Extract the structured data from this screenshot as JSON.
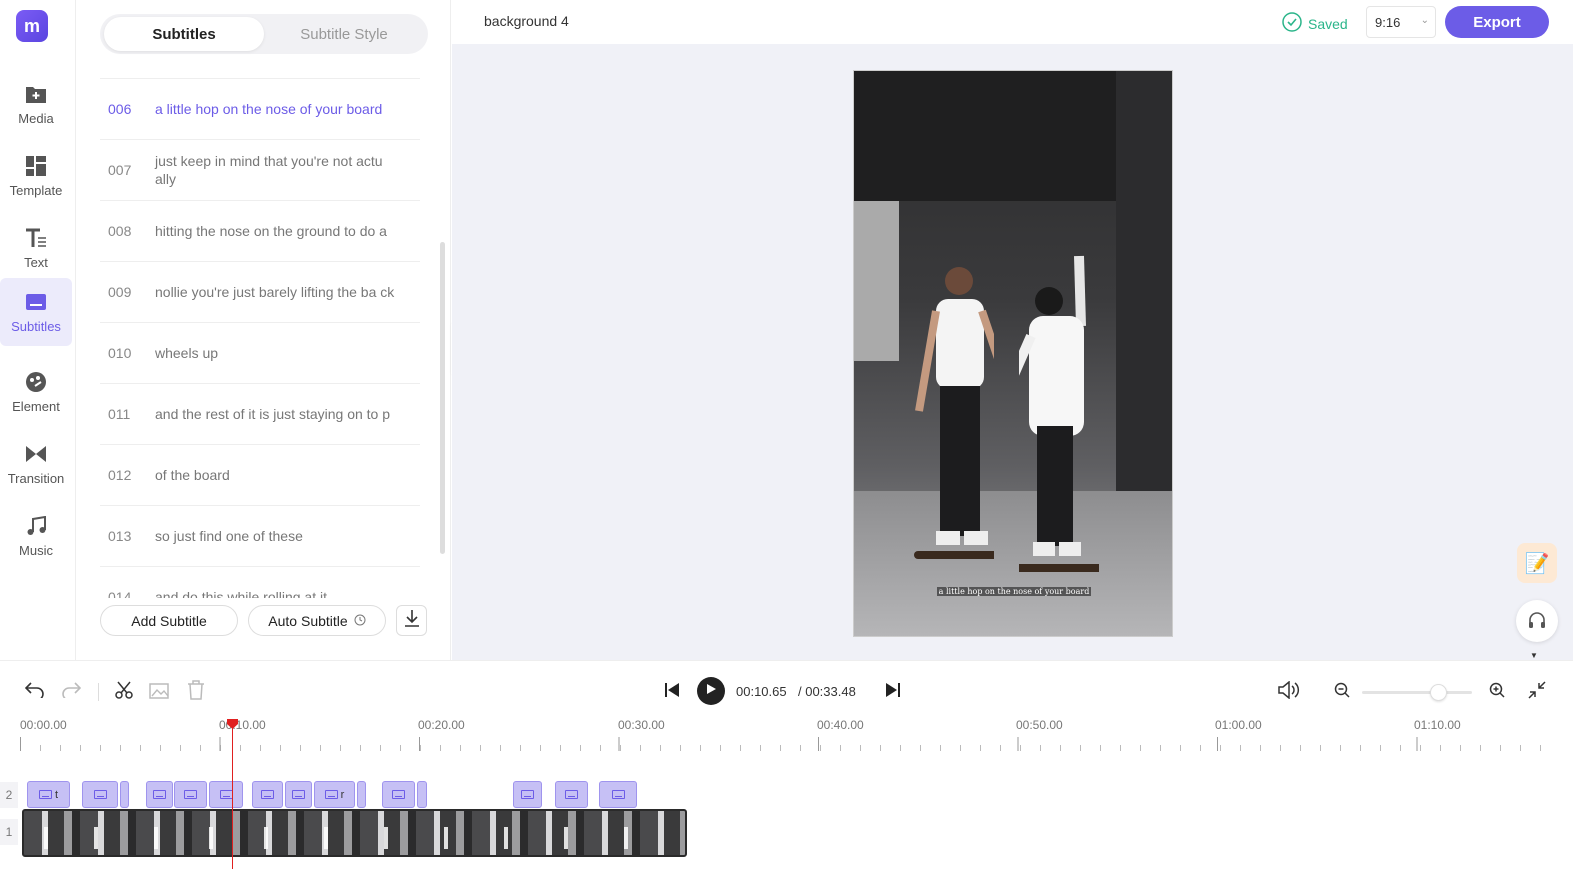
{
  "app": {
    "logo_letter": "m"
  },
  "rail": [
    {
      "label": "Media",
      "icon": "media-icon"
    },
    {
      "label": "Template",
      "icon": "template-icon"
    },
    {
      "label": "Text",
      "icon": "text-icon"
    },
    {
      "label": "Subtitles",
      "icon": "subtitles-icon",
      "active": true
    },
    {
      "label": "Element",
      "icon": "element-icon"
    },
    {
      "label": "Transition",
      "icon": "transition-icon"
    },
    {
      "label": "Music",
      "icon": "music-icon"
    }
  ],
  "panel": {
    "tabs": [
      "Subtitles",
      "Subtitle Style"
    ],
    "subtitles": [
      {
        "num": "006",
        "text": "a little hop on the nose of your board",
        "active": true
      },
      {
        "num": "007",
        "text": "just keep in mind that you're not actu ally"
      },
      {
        "num": "008",
        "text": "hitting the nose on the ground to do a"
      },
      {
        "num": "009",
        "text": "nollie you're just barely lifting the ba ck"
      },
      {
        "num": "010",
        "text": "wheels up"
      },
      {
        "num": "011",
        "text": "and the rest of it is just staying on to p"
      },
      {
        "num": "012",
        "text": "of the board"
      },
      {
        "num": "013",
        "text": "so just find one of these"
      },
      {
        "num": "014",
        "text": "and do this while rolling at it"
      }
    ],
    "add_subtitle": "Add Subtitle",
    "auto_subtitle": "Auto Subtitle"
  },
  "topbar": {
    "project_title": "background 4",
    "saved": "Saved",
    "ratio": "9:16",
    "export": "Export"
  },
  "preview": {
    "caption": "a little hop on the nose of your board"
  },
  "timeline": {
    "current_time": "00:10.65",
    "total_time": "/ 00:33.48",
    "ruler": [
      "00:00.00",
      "00:10.00",
      "00:20.00",
      "00:30.00",
      "00:40.00",
      "00:50.00",
      "01:00.00",
      "01:10.00"
    ],
    "tracks": [
      "2",
      "1"
    ],
    "clips": [
      {
        "t": "t"
      },
      {
        "t": ""
      },
      {
        "t": ""
      },
      {
        "t": ""
      },
      {
        "t": ""
      },
      {
        "t": ""
      },
      {
        "t": ""
      },
      {
        "t": ""
      },
      {
        "t": "r"
      },
      {
        "t": ""
      },
      {
        "t": ""
      },
      {
        "t": ""
      },
      {
        "t": ""
      },
      {
        "t": ""
      }
    ]
  },
  "colors": {
    "accent": "#6c5ce7",
    "saved": "#2bb58a",
    "playhead": "#e02020"
  }
}
